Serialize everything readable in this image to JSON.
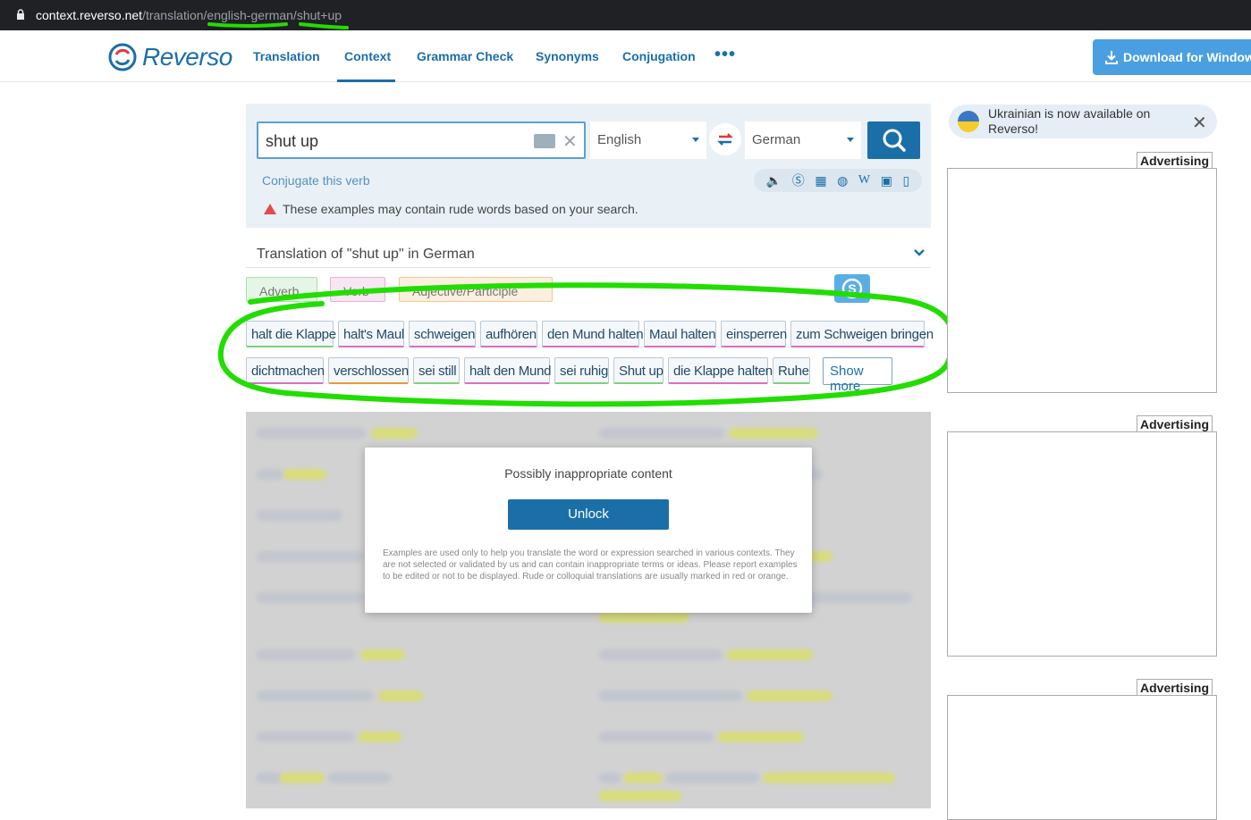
{
  "browser": {
    "url_host": "context.reverso.net",
    "url_path": "/translation/english-german/shut+up"
  },
  "nav": {
    "logo_text": "Reverso",
    "items": [
      "Translation",
      "Context",
      "Grammar Check",
      "Synonyms",
      "Conjugation"
    ],
    "active": "Context",
    "more_label": "•••",
    "download_label": "Download for Windows"
  },
  "search": {
    "query": "shut up",
    "source_lang": "English",
    "target_lang": "German",
    "conjugate_link": "Conjugate this verb",
    "warning": "These examples may contain rude words based on your search."
  },
  "translation": {
    "heading": "Translation of \"shut up\" in German",
    "pos_tags": [
      "Adverb",
      "Verb",
      "Adjective/Participle"
    ],
    "chips_row1": [
      "halt die Klappe",
      "halt's Maul",
      "schweigen",
      "aufhören",
      "den Mund halten",
      "Maul halten",
      "einsperren",
      "zum Schweigen bringen"
    ],
    "chips_row2": [
      "dichtmachen",
      "verschlossen",
      "sei still",
      "halt den Mund",
      "sei ruhig",
      "Shut up",
      "die Klappe halten",
      "Ruhe"
    ],
    "show_more": "Show more"
  },
  "modal": {
    "title": "Possibly inappropriate content",
    "unlock": "Unlock",
    "disclaimer": "Examples are used only to help you translate the word or expression searched in various contexts. They are not selected or validated by us and can contain inappropriate terms or ideas. Please report examples to be edited or not to be displayed. Rude or colloquial translations are usually marked in red or orange."
  },
  "sidebar": {
    "notice": "Ukrainian is now available on Reverso!",
    "ad_label": "Advertising"
  },
  "colors": {
    "brand": "#1b6fa8",
    "annotation_green": "#22dd00",
    "search_panel": "#e9f1f7"
  }
}
